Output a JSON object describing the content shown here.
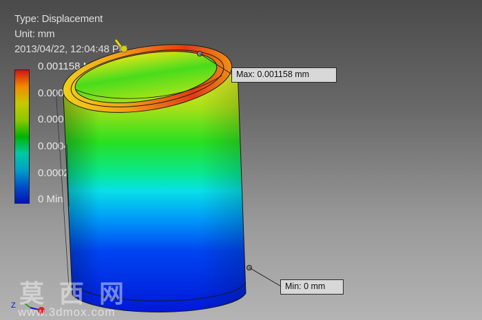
{
  "info": {
    "type_line": "Type: Displacement",
    "unit_line": "Unit: mm",
    "date_line": "2013/04/22, 12:04:48 PM"
  },
  "color_scale": {
    "colors_top_to_bottom": [
      "#d21414",
      "#f08c00",
      "#c8c800",
      "#8cc800",
      "#00b400",
      "#00c8a0",
      "#00a0c8",
      "#0050c8",
      "#0014b4"
    ],
    "labels": [
      {
        "text": "0.001158 Max",
        "level": 1.0
      },
      {
        "text": "0.000927",
        "level": 0.8
      },
      {
        "text": "0.000695",
        "level": 0.6
      },
      {
        "text": "0.000463",
        "level": 0.4
      },
      {
        "text": "0.000232",
        "level": 0.2
      },
      {
        "text": "0 Min",
        "level": 0.0
      }
    ]
  },
  "probes": {
    "max_label": "Max: 0.001158 mm",
    "min_label": "Min: 0 mm"
  },
  "axis": {
    "z_label": "Z"
  },
  "watermark": {
    "chars": "莫西网",
    "url": "www.3dmox.com"
  }
}
